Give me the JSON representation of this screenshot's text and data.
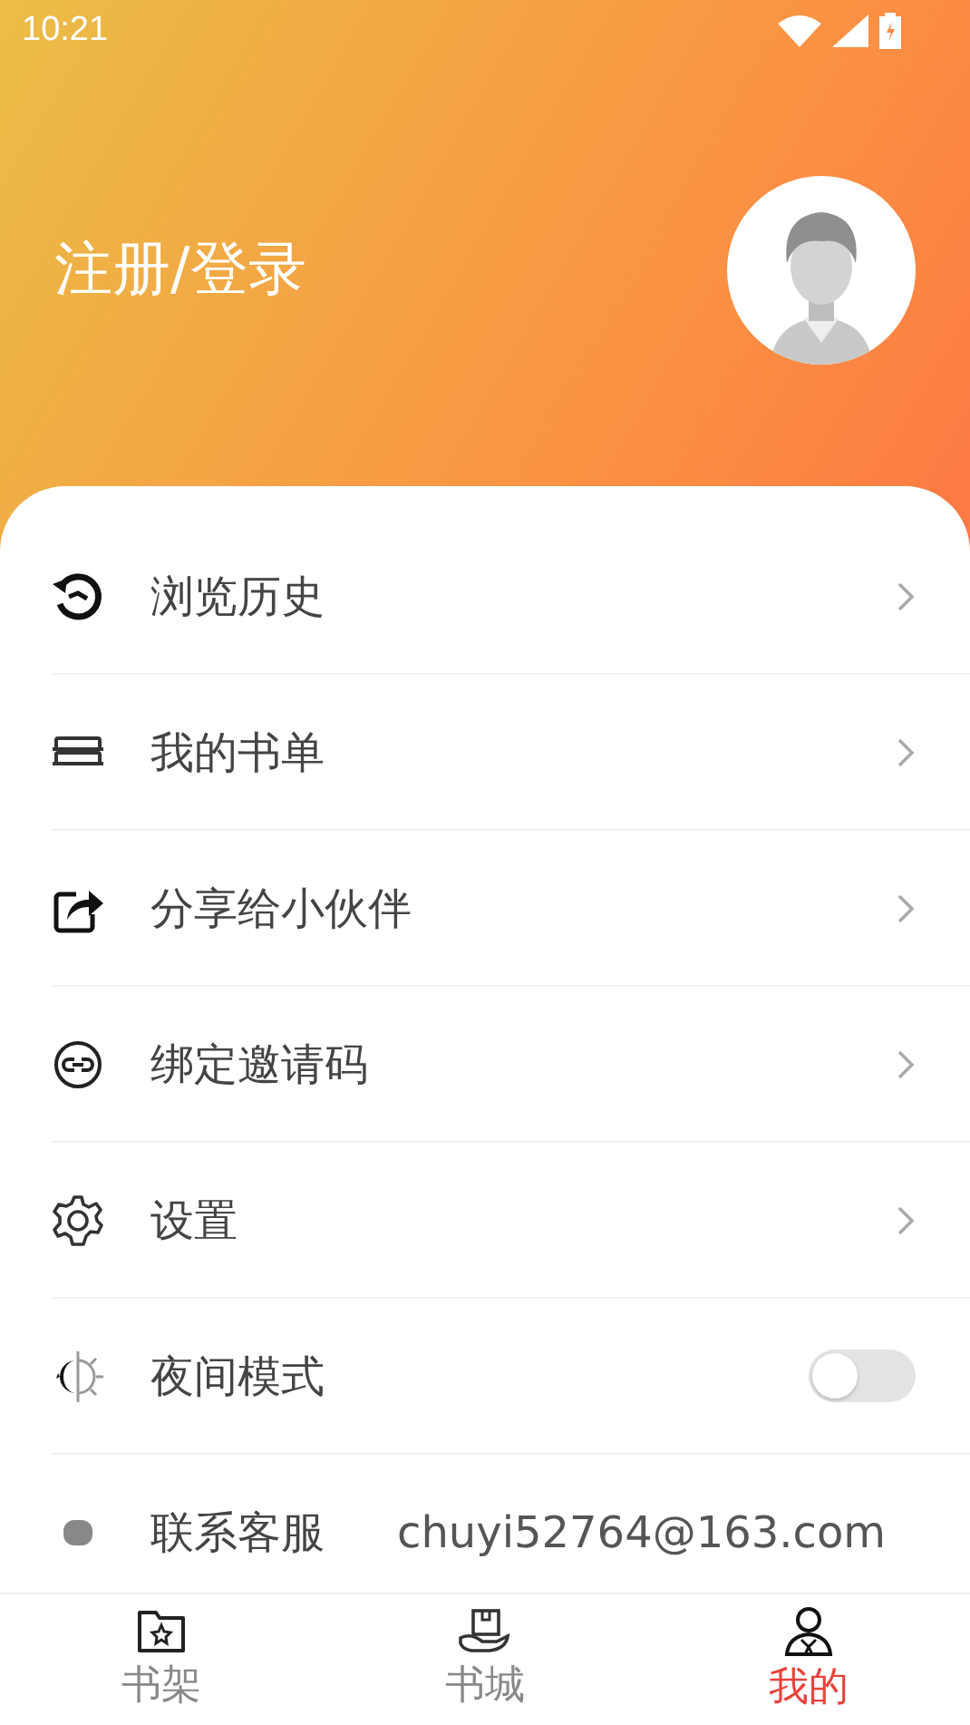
{
  "status_bar": {
    "time": "10:21"
  },
  "header": {
    "title": "注册/登录"
  },
  "menu": [
    {
      "kind": "link",
      "label": "浏览历史"
    },
    {
      "kind": "link",
      "label": "我的书单"
    },
    {
      "kind": "link",
      "label": "分享给小伙伴"
    },
    {
      "kind": "link",
      "label": "绑定邀请码"
    },
    {
      "kind": "link",
      "label": "设置"
    },
    {
      "kind": "toggle",
      "label": "夜间模式",
      "on": false
    },
    {
      "kind": "contact",
      "label": "联系客服",
      "value": "chuyi52764@163.com"
    }
  ],
  "bottom_nav": [
    {
      "label": "书架",
      "selected": false
    },
    {
      "label": "书城",
      "selected": false
    },
    {
      "label": "我的",
      "selected": true
    }
  ]
}
